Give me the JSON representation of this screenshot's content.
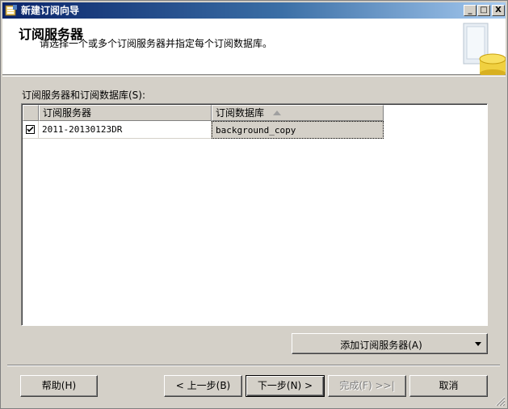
{
  "window": {
    "title": "新建订阅向导",
    "controls": {
      "minimize": "_",
      "maximize": "□",
      "close": "X"
    }
  },
  "header": {
    "title": "订阅服务器",
    "subtitle": "请选择一个或多个订阅服务器并指定每个订阅数据库。"
  },
  "grid": {
    "label": "订阅服务器和订阅数据库(S):",
    "columns": [
      "订阅服务器",
      "订阅数据库"
    ],
    "sorted_column": 1,
    "rows": [
      {
        "checked": true,
        "subscriber": "2011-20130123DR",
        "database": "background_copy"
      }
    ]
  },
  "add_subscriber_button": {
    "label": "添加订阅服务器(A)"
  },
  "buttons": {
    "help": "帮助(H)",
    "prev": "< 上一步(B)",
    "next": "下一步(N) >",
    "finish": "完成(F) >>|",
    "cancel": "取消"
  },
  "colors": {
    "titlebar_start": "#0a246a",
    "titlebar_end": "#a6caf0",
    "face": "#d4d0c8"
  }
}
